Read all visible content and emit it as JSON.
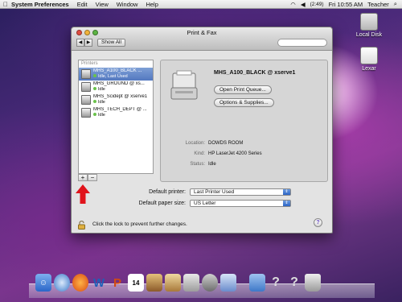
{
  "menubar": {
    "apple_icon": "apple-logo-icon",
    "app": "System Preferences",
    "items": [
      "Edit",
      "View",
      "Window",
      "Help"
    ],
    "battery": "(2:49)",
    "clock": "Fri 10:55 AM",
    "user": "Teacher"
  },
  "desktop": {
    "icons": [
      {
        "label": "Local Disk"
      },
      {
        "label": "Lexar"
      }
    ]
  },
  "window": {
    "title": "Print & Fax",
    "show_all_label": "Show All",
    "printers_header": "Printers",
    "printers": [
      {
        "name": "MHS_A100_BLACK ...",
        "status": "Idle, Last Used"
      },
      {
        "name": "MHS_GROUND @ xs...",
        "status": "Idle"
      },
      {
        "name": "MHS_Scidept @ xserve1",
        "status": "Idle"
      },
      {
        "name": "MHS_TECH_DEPT @ ...",
        "status": "Idle"
      }
    ],
    "add_label": "+",
    "remove_label": "−",
    "detail": {
      "printer_title": "MHS_A100_BLACK @ xserve1",
      "open_queue_label": "Open Print Queue...",
      "options_label": "Options & Supplies...",
      "location_label": "Location:",
      "location_value": "DOWDS ROOM",
      "kind_label": "Kind:",
      "kind_value": "HP LaserJet 4200 Series",
      "status_label": "Status:",
      "status_value": "Idle"
    },
    "default_printer_label": "Default printer:",
    "default_printer_value": "Last Printer Used",
    "default_paper_label": "Default paper size:",
    "default_paper_value": "US Letter",
    "lock_text": "Click the lock to prevent further changes.",
    "help_label": "?"
  },
  "colors": {
    "selection": "#5378c0",
    "annotation_arrow": "#e0141c"
  }
}
